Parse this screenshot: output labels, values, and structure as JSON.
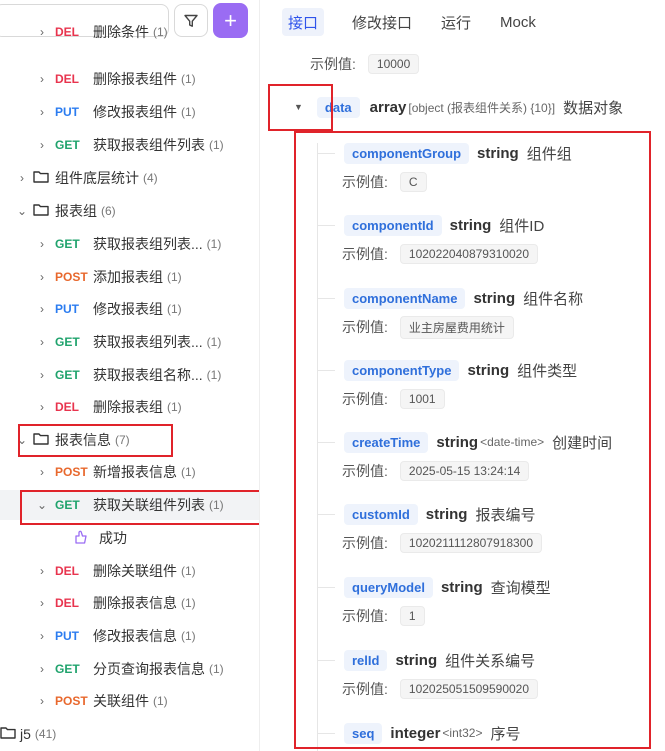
{
  "toolbar": {
    "add_label": "+"
  },
  "tree": [
    {
      "kind": "api",
      "chevron": "›",
      "method": "DEL",
      "label": "删除条件",
      "count": "(1)",
      "partial": true
    },
    {
      "kind": "api",
      "chevron": "›",
      "method": "DEL",
      "label": "删除报表组件",
      "count": "(1)"
    },
    {
      "kind": "api",
      "chevron": "›",
      "method": "PUT",
      "label": "修改报表组件",
      "count": "(1)"
    },
    {
      "kind": "api",
      "chevron": "›",
      "method": "GET",
      "label": "获取报表组件列表",
      "count": "(1)"
    },
    {
      "kind": "folder",
      "chevron": "›",
      "label": "组件底层统计",
      "count": "(4)"
    },
    {
      "kind": "folder",
      "chevron": "⌄",
      "label": "报表组",
      "count": "(6)"
    },
    {
      "kind": "api",
      "chevron": "›",
      "method": "GET",
      "label": "获取报表组列表...",
      "count": "(1)"
    },
    {
      "kind": "api",
      "chevron": "›",
      "method": "POST",
      "label": "添加报表组",
      "count": "(1)"
    },
    {
      "kind": "api",
      "chevron": "›",
      "method": "PUT",
      "label": "修改报表组",
      "count": "(1)"
    },
    {
      "kind": "api",
      "chevron": "›",
      "method": "GET",
      "label": "获取报表组列表...",
      "count": "(1)"
    },
    {
      "kind": "api",
      "chevron": "›",
      "method": "GET",
      "label": "获取报表组名称...",
      "count": "(1)"
    },
    {
      "kind": "api",
      "chevron": "›",
      "method": "DEL",
      "label": "删除报表组",
      "count": "(1)"
    },
    {
      "kind": "folder",
      "chevron": "⌄",
      "label": "报表信息",
      "count": "(7)"
    },
    {
      "kind": "api",
      "chevron": "›",
      "method": "POST",
      "label": "新增报表信息",
      "count": "(1)"
    },
    {
      "kind": "api",
      "chevron": "⌄",
      "method": "GET",
      "label": "获取关联组件列表",
      "count": "(1)",
      "selected": true
    },
    {
      "kind": "response",
      "label": "成功"
    },
    {
      "kind": "api",
      "chevron": "›",
      "method": "DEL",
      "label": "删除关联组件",
      "count": "(1)"
    },
    {
      "kind": "api",
      "chevron": "›",
      "method": "DEL",
      "label": "删除报表信息",
      "count": "(1)"
    },
    {
      "kind": "api",
      "chevron": "›",
      "method": "PUT",
      "label": "修改报表信息",
      "count": "(1)"
    },
    {
      "kind": "api",
      "chevron": "›",
      "method": "GET",
      "label": "分页查询报表信息",
      "count": "(1)"
    },
    {
      "kind": "api",
      "chevron": "›",
      "method": "POST",
      "label": "关联组件",
      "count": "(1)"
    },
    {
      "kind": "root",
      "label": "j5",
      "count": "(41)"
    }
  ],
  "tabs": [
    "接口",
    "修改接口",
    "运行",
    "Mock"
  ],
  "top_example": {
    "label": "示例值:",
    "value": "10000"
  },
  "data_field": {
    "name": "data",
    "type": "array",
    "subtype": "[object (报表组件关系) {10}]",
    "desc": "数据对象",
    "toggle": "▼"
  },
  "fields": [
    {
      "name": "componentGroup",
      "type": "string",
      "subtype": "",
      "desc": "组件组",
      "example_label": "示例值:",
      "example": "C"
    },
    {
      "name": "componentId",
      "type": "string",
      "subtype": "",
      "desc": "组件ID",
      "example_label": "示例值:",
      "example": "102022040879310020"
    },
    {
      "name": "componentName",
      "type": "string",
      "subtype": "",
      "desc": "组件名称",
      "example_label": "示例值:",
      "example": "业主房屋费用统计"
    },
    {
      "name": "componentType",
      "type": "string",
      "subtype": "",
      "desc": "组件类型",
      "example_label": "示例值:",
      "example": "1001"
    },
    {
      "name": "createTime",
      "type": "string",
      "subtype": "<date-time>",
      "desc": "创建时间",
      "example_label": "示例值:",
      "example": "2025-05-15 13:24:14"
    },
    {
      "name": "customId",
      "type": "string",
      "subtype": "",
      "desc": "报表编号",
      "example_label": "示例值:",
      "example": "1020211112807918300"
    },
    {
      "name": "queryModel",
      "type": "string",
      "subtype": "",
      "desc": "查询模型",
      "example_label": "示例值:",
      "example": "1"
    },
    {
      "name": "relId",
      "type": "string",
      "subtype": "",
      "desc": "组件关系编号",
      "example_label": "示例值:",
      "example": "102025051509590020"
    },
    {
      "name": "seq",
      "type": "integer",
      "subtype": "<int32>",
      "desc": "序号",
      "example_label": "",
      "example": ""
    }
  ],
  "colors": {
    "accent": "#2f54eb",
    "add_button": "#9a6cf3",
    "highlight_box": "#e0232a"
  }
}
